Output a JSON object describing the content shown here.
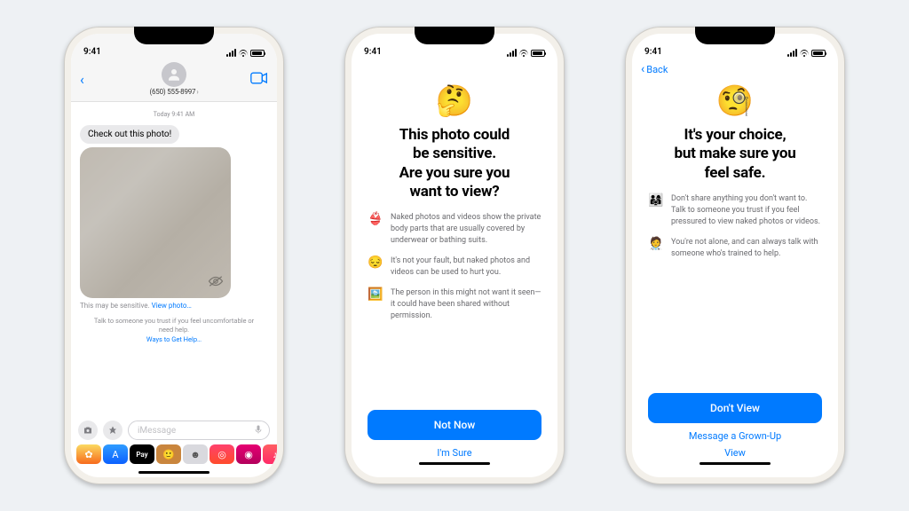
{
  "status": {
    "time": "9:41"
  },
  "phone1": {
    "contact": "(650) 555-8997",
    "timestamp": "Today 9:41 AM",
    "incoming_text": "Check out this photo!",
    "sensitive_label": "This may be sensitive.",
    "view_photo_link": "View photo…",
    "help_text": "Talk to someone you trust if you feel uncomfortable or need help.",
    "help_link": "Ways to Get Help…",
    "input_placeholder": "iMessage"
  },
  "phone2": {
    "emoji": "🤔",
    "title_l1": "This photo could",
    "title_l2": "be sensitive.",
    "title_l3": "Are you sure you",
    "title_l4": "want to view?",
    "bullets": [
      {
        "emoji": "👙",
        "text": "Naked photos and videos show the private body parts that are usually covered by underwear or bathing suits."
      },
      {
        "emoji": "😔",
        "text": "It's not your fault, but naked photos and videos can be used to hurt you."
      },
      {
        "emoji": "🖼️",
        "text": "The person in this might not want it seen—it could have been shared without permission."
      }
    ],
    "primary": "Not Now",
    "secondary": "I'm Sure"
  },
  "phone3": {
    "back": "Back",
    "emoji": "🧐",
    "title_l1": "It's your choice,",
    "title_l2": "but make sure you",
    "title_l3": "feel safe.",
    "bullets": [
      {
        "emoji": "👨‍👩‍👧",
        "text": "Don't share anything you don't want to. Talk to someone you trust if you feel pressured to view naked photos or videos."
      },
      {
        "emoji": "🧑‍⚕️",
        "text": "You're not alone, and can always talk with someone who's trained to help."
      }
    ],
    "primary": "Don't View",
    "secondary": "Message a Grown-Up",
    "tertiary": "View"
  }
}
